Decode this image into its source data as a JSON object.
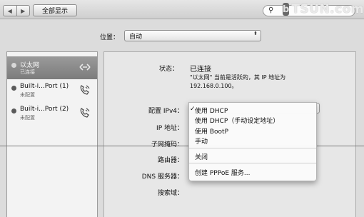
{
  "toolbar": {
    "back": "◀",
    "forward": "▶",
    "show_all": "全部显示",
    "search_value": ""
  },
  "watermark": {
    "logo": "b",
    "text": "TSUN.com"
  },
  "location": {
    "label": "位置：",
    "value": "自动",
    "arrows": "⬍"
  },
  "services": [
    {
      "name": "以太网",
      "status": "已连接",
      "selected": true
    },
    {
      "name": "Built-i...Port (1)",
      "status": "未配置",
      "selected": false
    },
    {
      "name": "Built-i...Port (2)",
      "status": "未配置",
      "selected": false
    }
  ],
  "detail": {
    "status_label": "状态：",
    "status_value": "已连接",
    "status_desc_1": "\"以太网\" 当前是活跃的，其 IP 地址为",
    "status_desc_2": "192.168.0.100。",
    "config_label": "配置 IPv4：",
    "ip_label": "IP 地址：",
    "subnet_label": "子网掩码：",
    "router_label": "路由器：",
    "dns_label": "DNS 服务器：",
    "search_label": "搜索域："
  },
  "ipv4_menu": {
    "check": "✓",
    "items": [
      "使用 DHCP",
      "使用 DHCP（手动设定地址）",
      "使用 BootP",
      "手动"
    ],
    "off": "关闭",
    "pppoe": "创建 PPPoE 服务..."
  }
}
